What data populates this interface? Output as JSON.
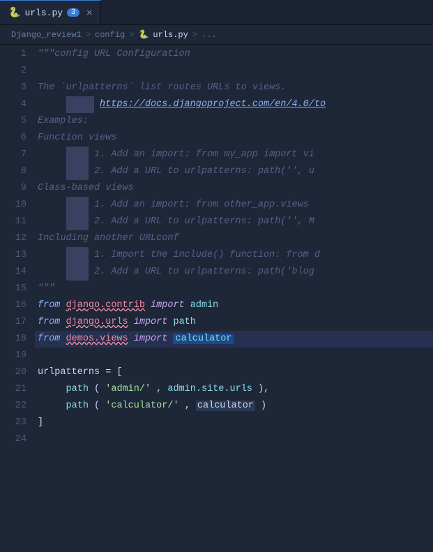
{
  "tab": {
    "icon": "🐍",
    "label": "urls.py",
    "badge": "3",
    "close": "✕"
  },
  "breadcrumb": {
    "parts": [
      "Django_review1",
      ">",
      "config",
      ">",
      "🐍 urls.py",
      ">",
      "..."
    ]
  },
  "lines": [
    {
      "num": 1,
      "content": "comment_docstring_open"
    },
    {
      "num": 2,
      "content": "empty"
    },
    {
      "num": 3,
      "content": "comment_urlpatterns"
    },
    {
      "num": 4,
      "content": "comment_url"
    },
    {
      "num": 5,
      "content": "comment_examples"
    },
    {
      "num": 6,
      "content": "comment_function"
    },
    {
      "num": 7,
      "content": "comment_add_import"
    },
    {
      "num": 8,
      "content": "comment_add_url"
    },
    {
      "num": 9,
      "content": "comment_class"
    },
    {
      "num": 10,
      "content": "comment_add_import2"
    },
    {
      "num": 11,
      "content": "comment_add_url2"
    },
    {
      "num": 12,
      "content": "comment_including"
    },
    {
      "num": 13,
      "content": "comment_import_include"
    },
    {
      "num": 14,
      "content": "comment_add_url3"
    },
    {
      "num": 15,
      "content": "comment_docstring_close"
    },
    {
      "num": 16,
      "content": "from_django_contrib"
    },
    {
      "num": 17,
      "content": "from_django_urls"
    },
    {
      "num": 18,
      "content": "from_demos_views",
      "active": true
    },
    {
      "num": 19,
      "content": "empty"
    },
    {
      "num": 20,
      "content": "urlpatterns"
    },
    {
      "num": 21,
      "content": "path_admin"
    },
    {
      "num": 22,
      "content": "path_calculator"
    },
    {
      "num": 23,
      "content": "close_bracket"
    },
    {
      "num": 24,
      "content": "empty"
    }
  ]
}
